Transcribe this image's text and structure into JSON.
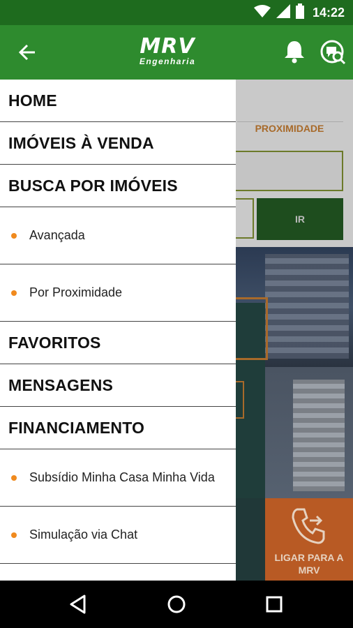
{
  "status_bar": {
    "time": "14:22",
    "icons": [
      "wifi-icon",
      "signal-icon",
      "battery-icon"
    ]
  },
  "app_bar": {
    "logo_main": "MRV",
    "logo_sub": "Engenharia",
    "icons": [
      "back-arrow-icon",
      "bell-icon",
      "chat-search-icon"
    ],
    "color": "#2e8b2e"
  },
  "background": {
    "tab_label": "PROXIMIDADE",
    "go_button": "IR",
    "call_tile": "LIGAR PARA A MRV"
  },
  "drawer": {
    "items": [
      {
        "label": "HOME"
      },
      {
        "label": "IMÓVEIS À VENDA"
      },
      {
        "label": "BUSCA POR IMÓVEIS"
      },
      {
        "label": "Avançada"
      },
      {
        "label": "Por Proximidade"
      },
      {
        "label": "FAVORITOS"
      },
      {
        "label": "MENSAGENS"
      },
      {
        "label": "FINANCIAMENTO"
      },
      {
        "label": "Subsídio Minha Casa Minha Vida"
      },
      {
        "label": "Simulação via Chat"
      }
    ],
    "bullet_color": "#f08a1e"
  },
  "nav_bar": {
    "icons": [
      "back-triangle-icon",
      "home-circle-icon",
      "recents-square-icon"
    ]
  }
}
